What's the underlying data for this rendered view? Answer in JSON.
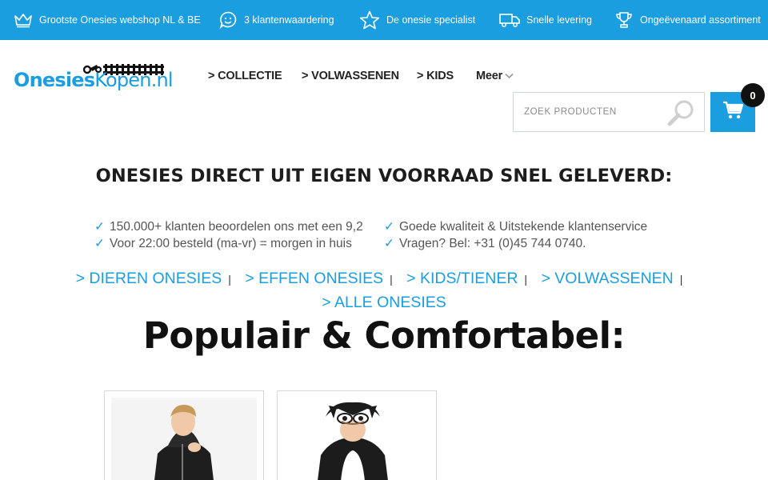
{
  "usp_bar": {
    "items": [
      {
        "icon": "crown-icon",
        "text": "Grootste Onesies webshop NL & BE"
      },
      {
        "icon": "smiley-icon",
        "text": "3 klantenwaardering"
      },
      {
        "icon": "star-icon",
        "text": "De onesie specialist"
      },
      {
        "icon": "truck-icon",
        "text": "Snelle levering"
      },
      {
        "icon": "trophy-icon",
        "text": "Ongeëvenaard assortiment"
      }
    ]
  },
  "header": {
    "logo": {
      "part1": "Onesies",
      "part2": "Kopen.nl"
    },
    "nav": [
      {
        "label": "> COLLECTIE"
      },
      {
        "label": "> VOLWASSENEN"
      },
      {
        "label": "> KIDS"
      },
      {
        "label": "Meer"
      }
    ],
    "search": {
      "placeholder": "ZOEK PRODUCTEN"
    },
    "cart": {
      "count": "0"
    }
  },
  "intro": {
    "headline": "ONESIES DIRECT UIT EIGEN VOORRAAD SNEL GELEVERD:",
    "check_mark": "✓",
    "usps_left": [
      "150.000+ klanten beoordelen ons met een 9,2",
      "Voor 22:00 besteld (ma-vr) = morgen in huis"
    ],
    "usps_right": [
      "Goede kwaliteit & Uitstekende klantenservice",
      "Vragen? Bel: +31 (0)45 744 0740."
    ],
    "category_links": [
      "> DIEREN ONESIES",
      "> EFFEN ONESIES",
      "> KIDS/TIENER",
      "> VOLWASSENEN",
      "> ALLE ONESIES"
    ],
    "separator": "|"
  },
  "products": {
    "title": "Populair & Comfortabel:"
  },
  "colors": {
    "accent": "#1a9ee0",
    "text_dark": "#1d1d1d",
    "badge": "#111111"
  }
}
